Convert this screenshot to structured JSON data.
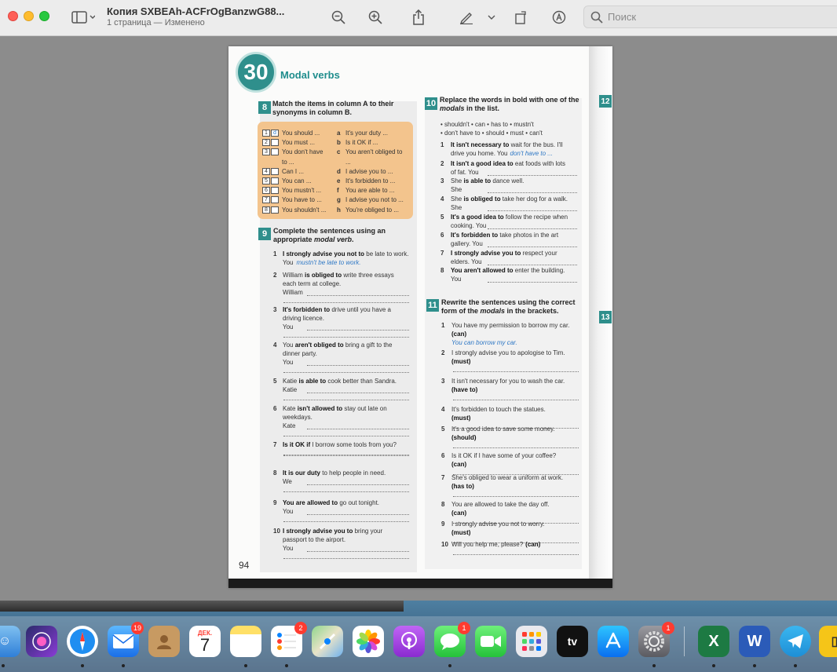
{
  "window": {
    "title": "Копия SXBEAh-ACFrOgBanzwG88...",
    "subtitle": "1 страница — Изменено",
    "search_placeholder": "Поиск"
  },
  "page": {
    "unit_number": "30",
    "unit_title": "Modal verbs",
    "page_number": "94",
    "side_badges": [
      "12",
      "13"
    ],
    "ex8": {
      "number": "8",
      "heading_line1": "Match the items in column A to their",
      "heading_line2": "synonyms in column B.",
      "rows": [
        {
          "n": "1",
          "ans": "d",
          "a": "You should ...",
          "l": "a",
          "b": "It's your duty ..."
        },
        {
          "n": "2",
          "ans": "",
          "a": "You must ...",
          "l": "b",
          "b": "Is it OK if ..."
        },
        {
          "n": "3",
          "ans": "",
          "a": "You don't have",
          "l": "c",
          "b": "You aren't obliged to"
        },
        {
          "n": "",
          "ans": "",
          "a": "to ...",
          "l": "",
          "b": "..."
        },
        {
          "n": "4",
          "ans": "",
          "a": "Can I ...",
          "l": "d",
          "b": "I advise you to ..."
        },
        {
          "n": "5",
          "ans": "",
          "a": "You can ...",
          "l": "e",
          "b": "It's forbidden to ..."
        },
        {
          "n": "6",
          "ans": "",
          "a": "You mustn't ...",
          "l": "f",
          "b": "You are able to ..."
        },
        {
          "n": "7",
          "ans": "",
          "a": "You have to ...",
          "l": "g",
          "b": "I advise you not to ..."
        },
        {
          "n": "8",
          "ans": "",
          "a": "You shouldn't ...",
          "l": "h",
          "b": "You're obliged to ..."
        }
      ]
    },
    "ex9": {
      "number": "9",
      "heading_line1": "Complete the sentences using an",
      "heading_line2": "appropriate modal verb.",
      "items": [
        {
          "n": "1",
          "bold": "I strongly advise you not to",
          "rest": " be late to work.",
          "line2": "You",
          "example": "mustn't be late to work."
        },
        {
          "n": "2",
          "pre": "William ",
          "bold": "is obliged to",
          "rest": " write three essays",
          "line2": "each term at college.",
          "line3": "William"
        },
        {
          "n": "3",
          "bold": "It's forbidden to",
          "rest": " drive until you have a",
          "line2": "driving licence.",
          "line3": "You"
        },
        {
          "n": "4",
          "pre": "You ",
          "bold": "aren't obliged to",
          "rest": " bring a gift to the",
          "line2": "dinner party.",
          "line3": "You"
        },
        {
          "n": "5",
          "pre": "Katie ",
          "bold": "is able to",
          "rest": " cook better than Sandra.",
          "line2": "Katie"
        },
        {
          "n": "6",
          "pre": "Kate ",
          "bold": "isn't allowed to",
          "rest": " stay out late on",
          "line2": "weekdays.",
          "line3": "Kate"
        },
        {
          "n": "7",
          "bold": "Is it OK if",
          "rest": " I borrow some tools from you?"
        },
        {
          "n": "8",
          "bold": "It is our duty",
          "rest": " to help people in need.",
          "line2": "We"
        },
        {
          "n": "9",
          "bold": "You are allowed to",
          "rest": " go out tonight.",
          "line2": "You"
        },
        {
          "n": "10",
          "bold": "I strongly advise you to",
          "rest": " bring your",
          "line2": "passport to the airport.",
          "line3": "You"
        }
      ]
    },
    "ex10": {
      "number": "10",
      "heading_line1": "Replace the words in bold with one of the",
      "heading_line2": "modals in the list.",
      "list_line1": "• shouldn't  • can  • has to  • mustn't",
      "list_line2": "• don't have to  • should  • must  • can't",
      "items": [
        {
          "n": "1",
          "bold": "It isn't necessary to",
          "rest": " wait for the bus. I'll",
          "line2": "drive you home. You",
          "example": "don't have to ..."
        },
        {
          "n": "2",
          "bold": "It isn't a good idea to",
          "rest": " eat foods with lots",
          "line2": "of fat. You"
        },
        {
          "n": "3",
          "pre": "She ",
          "bold": "is able to",
          "rest": " dance well.",
          "line2": "She"
        },
        {
          "n": "4",
          "pre": "She ",
          "bold": "is obliged to",
          "rest": " take her dog for a walk.",
          "line2": "She"
        },
        {
          "n": "5",
          "bold": "It's a good idea to",
          "rest": " follow the recipe when",
          "line2": "cooking. You"
        },
        {
          "n": "6",
          "bold": "It's forbidden to",
          "rest": " take photos in the art",
          "line2": "gallery. You"
        },
        {
          "n": "7",
          "bold": "I strongly advise you to",
          "rest": " respect your",
          "line2": "elders. You"
        },
        {
          "n": "8",
          "bold": "You aren't allowed to",
          "rest": " enter the building.",
          "line2": "You"
        }
      ]
    },
    "ex11": {
      "number": "11",
      "heading_line1": "Rewrite the sentences using the correct",
      "heading_line2": "form of the modals in the brackets.",
      "items": [
        {
          "n": "1",
          "text": "You have my permission to borrow my car.",
          "mod": "(can)",
          "example": "You can borrow my car."
        },
        {
          "n": "2",
          "text": "I strongly advise you to apologise to Tim.",
          "mod": "(must)"
        },
        {
          "n": "3",
          "text": "It isn't necessary for you to wash the car.",
          "mod": "(have to)"
        },
        {
          "n": "4",
          "text": "It's forbidden to touch the statues.",
          "mod": "(must)"
        },
        {
          "n": "5",
          "text": "It's a good idea to save some money.",
          "mod": "(should)"
        },
        {
          "n": "6",
          "text": "Is it OK if I have some of your coffee?",
          "mod": "(can)"
        },
        {
          "n": "7",
          "text": "She's obliged to wear a uniform at work.",
          "mod": "(has to)"
        },
        {
          "n": "8",
          "text": "You are allowed to take the day off.",
          "mod": "(can)"
        },
        {
          "n": "9",
          "text": "I strongly advise you not to worry.",
          "mod": "(must)"
        },
        {
          "n": "10",
          "text": "Will you help me, please?",
          "mod": "(can)"
        }
      ]
    }
  },
  "dock": {
    "mail_badge": "19",
    "calendar_month": "ДЕК.",
    "calendar_day": "7",
    "reminders_badge": "2",
    "messages_badge": "1",
    "settings_badge": "1",
    "apps": [
      "finder",
      "siri",
      "safari",
      "mail",
      "contacts",
      "calendar",
      "notes",
      "reminders",
      "maps",
      "photos",
      "podcasts",
      "messages",
      "facetime",
      "launchpad",
      "apple-tv",
      "app-store",
      "system-settings",
      "excel",
      "word",
      "telegram",
      "notes-yellow"
    ]
  }
}
